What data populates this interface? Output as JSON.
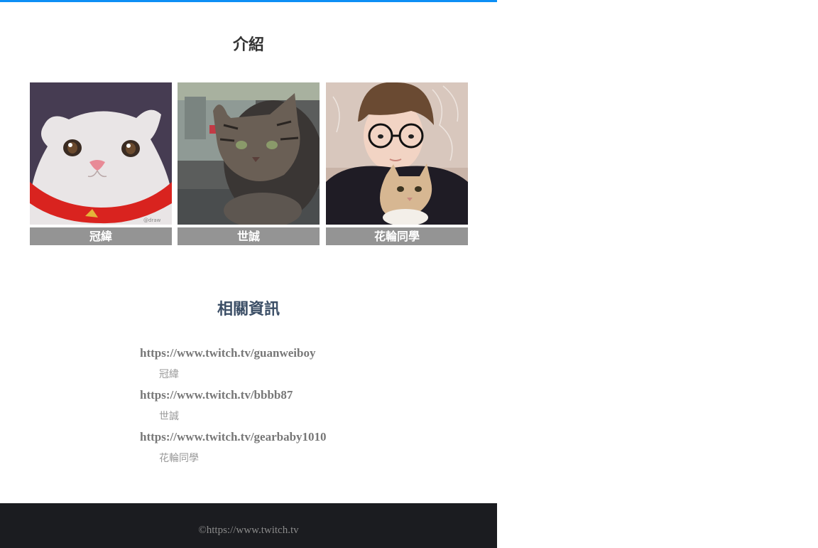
{
  "intro": {
    "title": "介紹",
    "cards": [
      {
        "name": "冠緯",
        "photo_icon": "cartoon-white-cat-icon"
      },
      {
        "name": "世誠",
        "photo_icon": "tabby-cat-photo-icon"
      },
      {
        "name": "花輪同學",
        "photo_icon": "person-with-cat-photo-icon"
      }
    ]
  },
  "info": {
    "title": "相關資訊",
    "links": [
      {
        "url": "https://www.twitch.tv/guanweiboy",
        "desc": "冠緯"
      },
      {
        "url": "https://www.twitch.tv/bbbb87",
        "desc": "世誠"
      },
      {
        "url": "https://www.twitch.tv/gearbaby1010",
        "desc": "花輪同學"
      }
    ]
  },
  "footer": {
    "text": "©https://www.twitch.tv"
  },
  "colors": {
    "accent": "#0d8ff5",
    "caption_bg": "#949494",
    "footer_bg": "#1b1c20"
  }
}
